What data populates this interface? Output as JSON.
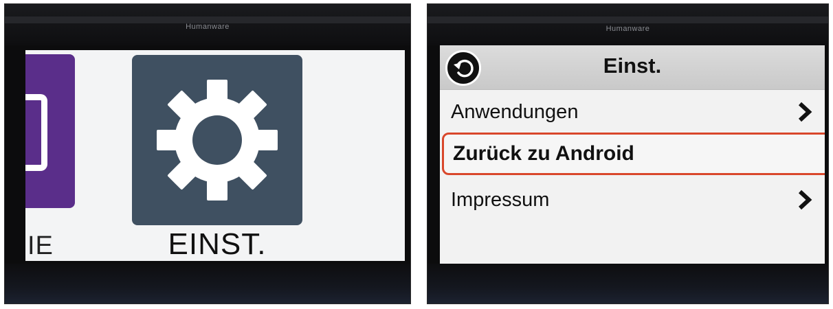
{
  "left_photo": {
    "brand": "Humanware",
    "apps": [
      {
        "label": "IE",
        "icon": "document-icon",
        "color": "#5a2e8a"
      },
      {
        "label": "EINST.",
        "icon": "gear-icon",
        "color": "#3f5061"
      }
    ]
  },
  "right_photo": {
    "brand": "Humanware",
    "header": {
      "title": "Einst.",
      "back_icon": "back-icon"
    },
    "menu": [
      {
        "label": "Anwendungen",
        "has_chevron": true
      },
      {
        "label": "Zurück zu Android",
        "has_chevron": false,
        "highlighted": true,
        "highlight_color": "#d9472b"
      },
      {
        "label": "Impressum",
        "has_chevron": true
      }
    ]
  }
}
